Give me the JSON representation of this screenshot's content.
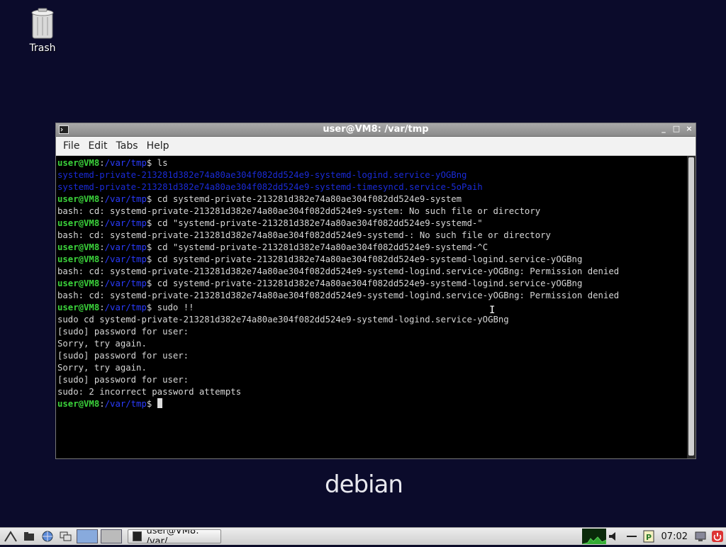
{
  "desktop": {
    "trash_label": "Trash",
    "wallpaper_text": "debian"
  },
  "window": {
    "title": "user@VM8: /var/tmp",
    "menu": [
      "File",
      "Edit",
      "Tabs",
      "Help"
    ],
    "controls": {
      "minimize": "_",
      "maximize": "□",
      "close": "×"
    }
  },
  "terminal": {
    "lines": [
      {
        "kind": "prompt",
        "user": "user@VM8",
        "sep": ":",
        "path": "/var/tmp",
        "dollar": "$",
        "cmd": " ls"
      },
      {
        "kind": "faint",
        "text": "systemd-private-213281d382e74a80ae304f082dd524e9-systemd-logind.service-yOGBng"
      },
      {
        "kind": "faint",
        "text": "systemd-private-213281d382e74a80ae304f082dd524e9-systemd-timesyncd.service-5oPaih"
      },
      {
        "kind": "prompt",
        "user": "user@VM8",
        "sep": ":",
        "path": "/var/tmp",
        "dollar": "$",
        "cmd": " cd systemd-private-213281d382e74a80ae304f082dd524e9-system"
      },
      {
        "kind": "out",
        "text": "bash: cd: systemd-private-213281d382e74a80ae304f082dd524e9-system: No such file or directory"
      },
      {
        "kind": "prompt",
        "user": "user@VM8",
        "sep": ":",
        "path": "/var/tmp",
        "dollar": "$",
        "cmd": " cd \"systemd-private-213281d382e74a80ae304f082dd524e9-systemd-\""
      },
      {
        "kind": "out",
        "text": "bash: cd: systemd-private-213281d382e74a80ae304f082dd524e9-systemd-: No such file or directory"
      },
      {
        "kind": "prompt",
        "user": "user@VM8",
        "sep": ":",
        "path": "/var/tmp",
        "dollar": "$",
        "cmd": " cd \"systemd-private-213281d382e74a80ae304f082dd524e9-systemd-^C"
      },
      {
        "kind": "prompt",
        "user": "user@VM8",
        "sep": ":",
        "path": "/var/tmp",
        "dollar": "$",
        "cmd": " cd systemd-private-213281d382e74a80ae304f082dd524e9-systemd-logind.service-yOGBng"
      },
      {
        "kind": "out",
        "text": "bash: cd: systemd-private-213281d382e74a80ae304f082dd524e9-systemd-logind.service-yOGBng: Permission denied"
      },
      {
        "kind": "prompt",
        "user": "user@VM8",
        "sep": ":",
        "path": "/var/tmp",
        "dollar": "$",
        "cmd": " cd systemd-private-213281d382e74a80ae304f082dd524e9-systemd-logind.service-yOGBng"
      },
      {
        "kind": "out",
        "text": "bash: cd: systemd-private-213281d382e74a80ae304f082dd524e9-systemd-logind.service-yOGBng: Permission denied"
      },
      {
        "kind": "prompt",
        "user": "user@VM8",
        "sep": ":",
        "path": "/var/tmp",
        "dollar": "$",
        "cmd": " sudo !!"
      },
      {
        "kind": "out",
        "text": "sudo cd systemd-private-213281d382e74a80ae304f082dd524e9-systemd-logind.service-yOGBng"
      },
      {
        "kind": "out",
        "text": "[sudo] password for user:"
      },
      {
        "kind": "out",
        "text": "Sorry, try again."
      },
      {
        "kind": "out",
        "text": "[sudo] password for user:"
      },
      {
        "kind": "out",
        "text": "Sorry, try again."
      },
      {
        "kind": "out",
        "text": "[sudo] password for user:"
      },
      {
        "kind": "out",
        "text": "sudo: 2 incorrect password attempts"
      },
      {
        "kind": "prompt",
        "user": "user@VM8",
        "sep": ":",
        "path": "/var/tmp",
        "dollar": "$",
        "cmd": " ",
        "cursor": true
      }
    ]
  },
  "taskbar": {
    "task_label": "user@VM8: /var/...",
    "clock": "07:02"
  }
}
